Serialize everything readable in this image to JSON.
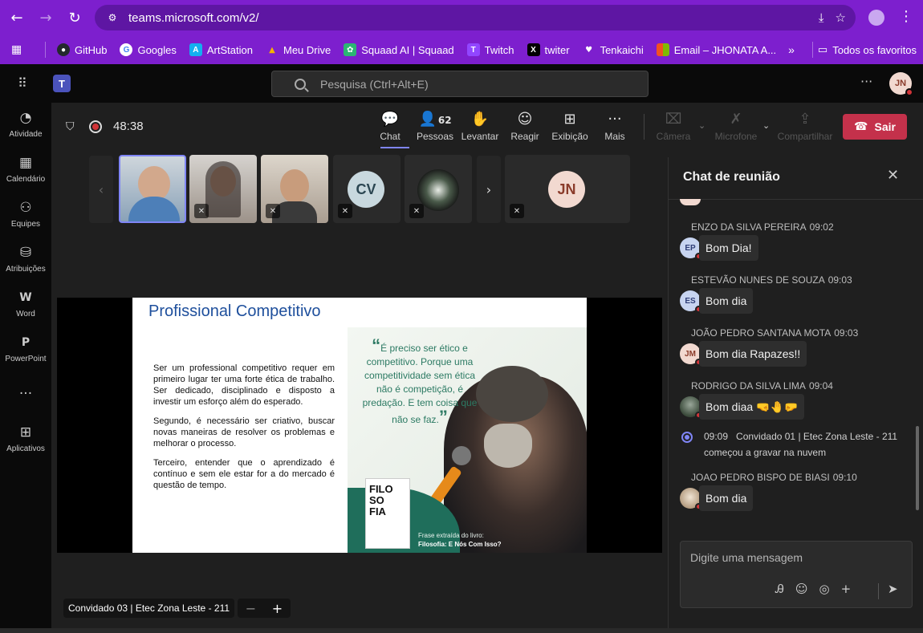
{
  "browser": {
    "url": "teams.microsoft.com/v2/",
    "bookmarks": [
      {
        "label": "GitHub",
        "color": "#24292e",
        "glyph": "G"
      },
      {
        "label": "Googles",
        "color": "#4285f4",
        "glyph": "G"
      },
      {
        "label": "ArtStation",
        "color": "#13aff0",
        "glyph": "A"
      },
      {
        "label": "Meu Drive",
        "color": "#1fa463",
        "glyph": "▲"
      },
      {
        "label": "Squaad AI | Squaad",
        "color": "#2bb673",
        "glyph": "✿"
      },
      {
        "label": "Twitch",
        "color": "#9146ff",
        "glyph": "T"
      },
      {
        "label": "twiter",
        "color": "#000000",
        "glyph": "X"
      },
      {
        "label": "Tenkaichi",
        "color": "#ffffff",
        "glyph": "♥"
      },
      {
        "label": "Email – JHONATA A...",
        "color": "#f25022",
        "glyph": "■"
      }
    ],
    "more_label": "»",
    "all_favorites": "Todos os favoritos"
  },
  "teams": {
    "search_placeholder": "Pesquisa (Ctrl+Alt+E)",
    "user_initials": "JN",
    "rail": [
      {
        "label": "Atividade",
        "icon": "bell-icon",
        "glyph": "🔔"
      },
      {
        "label": "Calendário",
        "icon": "calendar-icon",
        "glyph": "▦"
      },
      {
        "label": "Equipes",
        "icon": "teams-icon",
        "glyph": "⚇"
      },
      {
        "label": "Atribuições",
        "icon": "assignments-icon",
        "glyph": "⛁"
      },
      {
        "label": "Word",
        "icon": "word-icon",
        "glyph": "W"
      },
      {
        "label": "PowerPoint",
        "icon": "powerpoint-icon",
        "glyph": "P"
      },
      {
        "label": "",
        "icon": "more-icon",
        "glyph": "···"
      },
      {
        "label": "Aplicativos",
        "icon": "apps-add-icon",
        "glyph": "⊞"
      }
    ]
  },
  "meeting": {
    "timer": "48:38",
    "toolbar": {
      "chat": "Chat",
      "people": "Pessoas",
      "people_count": "62",
      "raise": "Levantar",
      "react": "Reagir",
      "view": "Exibição",
      "more": "Mais",
      "camera": "Câmera",
      "mic": "Microfone",
      "share": "Compartilhar",
      "leave": "Sair"
    },
    "participants": [
      {
        "initials": "CV",
        "bg": "#c8d8de",
        "fg": "#2b4652"
      },
      {
        "initials": "JN",
        "bg": "#f2d9d0",
        "fg": "#8a3b2a"
      }
    ],
    "slide": {
      "title": "Profissional Competitivo",
      "paragraphs": [
        "Ser um professional competitivo requer em primeiro lugar ter uma forte ética de trabalho. Ser dedicado, disciplinado e disposto a investir um esforço além do esperado.",
        "Segundo, é necessário ser criativo, buscar novas maneiras de resolver os problemas e melhorar o processo.",
        "Terceiro, entender que o aprendizado é contínuo e sem ele estar for a do mercado é questão de tempo."
      ],
      "quote": "É preciso ser ético e competitivo. Porque uma competitividade sem ética não é competição, é predação. E tem coisa que não se faz.",
      "book_title": "FILO SO FIA",
      "caption_line1": "Frase extraída do livro:",
      "caption_line2": "Filosofia: E Nós Com Isso?"
    },
    "presenter_name": "Convidado 03 | Etec Zona Leste - 211"
  },
  "chat": {
    "title": "Chat de reunião",
    "messages": [
      {
        "author": "ENZO DA SILVA PEREIRA",
        "time": "09:02",
        "initials": "EP",
        "text": "Bom Dia!",
        "avatar_bg": "#c7d4f0",
        "avatar_fg": "#2f3e77"
      },
      {
        "author": "ESTEVÃO NUNES DE SOUZA",
        "time": "09:03",
        "initials": "ES",
        "text": "Bom dia",
        "avatar_bg": "#c7d4f0",
        "avatar_fg": "#2f3e77"
      },
      {
        "author": "JOÃO PEDRO SANTANA MOTA",
        "time": "09:03",
        "initials": "JM",
        "text": "Bom dia Rapazes!!",
        "avatar_bg": "#f2d9d0",
        "avatar_fg": "#8a3b2a"
      },
      {
        "author": "RODRIGO DA SILVA LIMA",
        "time": "09:04",
        "initials": "",
        "text": "Bom diaa 🤜🤚🤛",
        "avatar_bg": "#5a6a5a",
        "avatar_fg": "#ffffff"
      },
      {
        "author": "JOAO PEDRO BISPO DE BIASI",
        "time": "09:10",
        "initials": "",
        "text": "Bom dia",
        "avatar_bg": "#d8cfc0",
        "avatar_fg": "#333333"
      }
    ],
    "system": {
      "time": "09:09",
      "text_line1": "Convidado 01 | Etec Zona Leste - 211",
      "text_line2": "começou a gravar na nuvem"
    },
    "composer_placeholder": "Digite uma mensagem"
  }
}
